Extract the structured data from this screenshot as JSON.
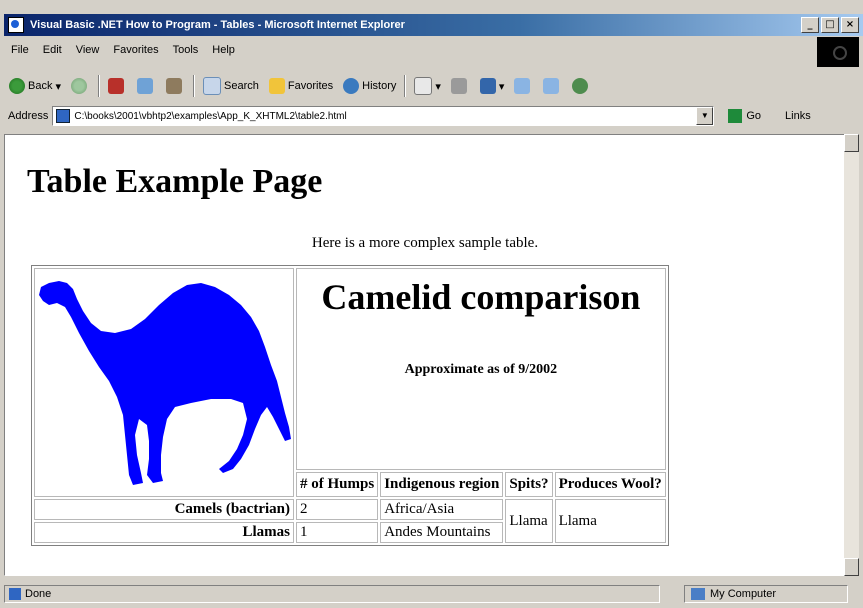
{
  "window": {
    "title": "Visual Basic .NET How to Program - Tables - Microsoft Internet Explorer",
    "buttons": {
      "minimize": "_",
      "maximize": "□",
      "close": "×"
    }
  },
  "menu": [
    "File",
    "Edit",
    "View",
    "Favorites",
    "Tools",
    "Help"
  ],
  "toolbar": {
    "back": "Back",
    "search": "Search",
    "favorites": "Favorites",
    "history": "History"
  },
  "address": {
    "label": "Address",
    "url": "C:\\books\\2001\\vbhtp2\\examples\\App_K_XHTML2\\table2.html",
    "go": "Go",
    "links": "Links"
  },
  "page": {
    "heading": "Table Example Page",
    "intro": "Here is a more complex sample table.",
    "table": {
      "caption_title": "Camelid comparison",
      "caption_subtitle": "Approximate as of 9/2002",
      "headers": [
        "# of Humps",
        "Indigenous region",
        "Spits?",
        "Produces Wool?"
      ],
      "rows": [
        {
          "name": "Camels (bactrian)",
          "humps": "2",
          "region": "Africa/Asia"
        },
        {
          "name": "Llamas",
          "humps": "1",
          "region": "Andes Mountains"
        }
      ],
      "spits": "Llama",
      "wool": "Llama"
    }
  },
  "status": {
    "left": "Done",
    "zone": "My Computer"
  },
  "colors": {
    "camel": "#0000ff",
    "titlebar_start": "#0a246a",
    "chrome": "#d4d0c8"
  }
}
